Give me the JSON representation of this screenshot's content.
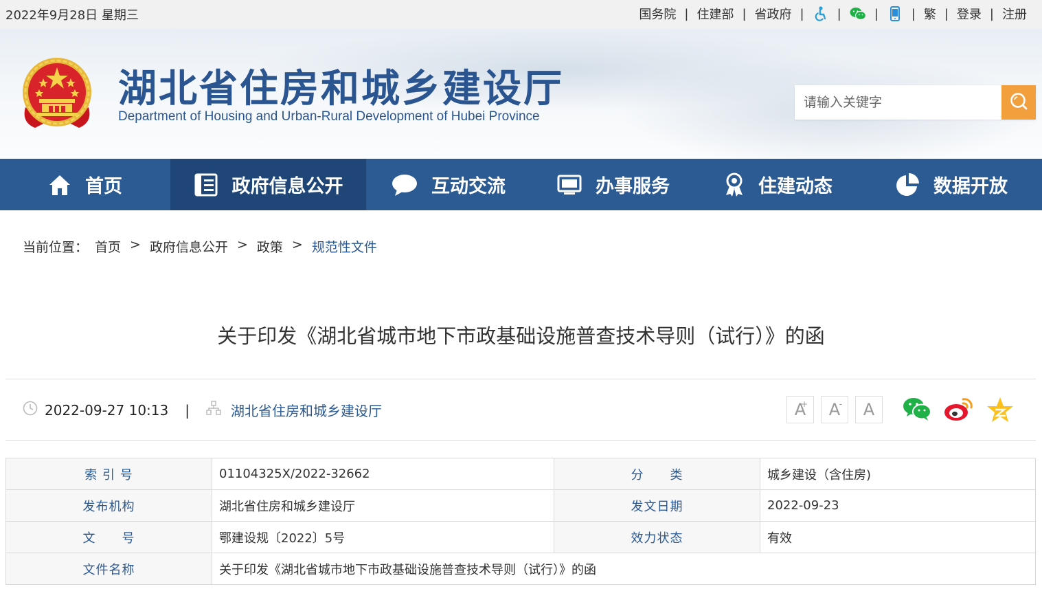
{
  "topbar": {
    "date": "2022年9月28日 星期三",
    "links": [
      "国务院",
      "住建部",
      "省政府"
    ],
    "icons": [
      "accessibility-icon",
      "wechat-icon",
      "mobile-icon"
    ],
    "traditional": "繁",
    "login": "登录",
    "register": "注册"
  },
  "header": {
    "title": "湖北省住房和城乡建设厅",
    "subtitle": "Department of Housing and Urban-Rural Development of Hubei Province",
    "search_placeholder": "请输入关键字"
  },
  "nav": {
    "items": [
      {
        "label": "首页",
        "icon": "home-icon"
      },
      {
        "label": "政府信息公开",
        "icon": "document-icon",
        "active": true
      },
      {
        "label": "互动交流",
        "icon": "chat-bubble-icon"
      },
      {
        "label": "办事服务",
        "icon": "monitor-icon"
      },
      {
        "label": "住建动态",
        "icon": "award-ribbon-icon"
      },
      {
        "label": "数据开放",
        "icon": "pie-chart-icon"
      }
    ]
  },
  "breadcrumb": {
    "prefix": "当前位置：",
    "items": [
      "首页",
      "政府信息公开",
      "政策",
      "规范性文件"
    ],
    "separator": ">"
  },
  "article": {
    "title": "关于印发《湖北省城市地下市政基础设施普查技术导则（试行）》的函",
    "datetime": "2022-09-27 10:13",
    "divider": "|",
    "publisher": "湖北省住房和城乡建设厅",
    "font_buttons": [
      "A",
      "A",
      "A"
    ],
    "font_button_marks": [
      "+",
      "-"
    ]
  },
  "info_table": {
    "rows": [
      [
        {
          "label": "索 引 号",
          "value": "01104325X/2022-32662"
        },
        {
          "label": "分　　类",
          "value": "城乡建设（含住房)"
        }
      ],
      [
        {
          "label": "发布机构",
          "value": "湖北省住房和城乡建设厅"
        },
        {
          "label": "发文日期",
          "value": "2022-09-23"
        }
      ],
      [
        {
          "label": "文　　号",
          "value": "鄂建设规〔2022〕5号"
        },
        {
          "label": "效力状态",
          "value": "有效"
        }
      ]
    ],
    "full_row": {
      "label": "文件名称",
      "value": "关于印发《湖北省城市地下市政基础设施普查技术导则（试行）》的函"
    }
  },
  "colors": {
    "nav_bg": "#2c5a92",
    "nav_active": "#1f4677",
    "search_btn": "#f2a03d",
    "title_blue": "#2a5590"
  }
}
